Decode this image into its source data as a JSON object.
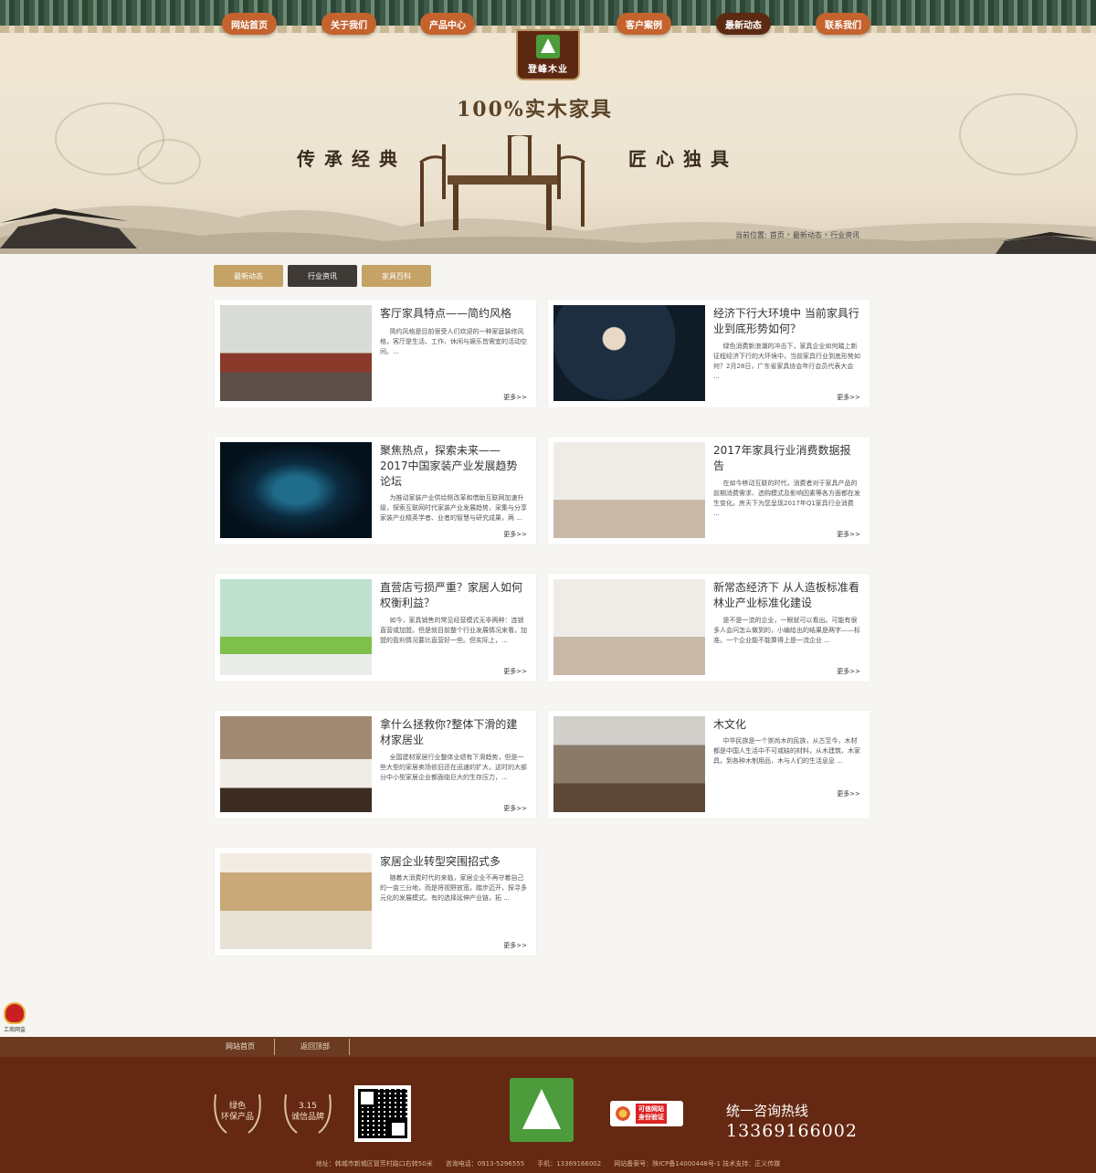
{
  "nav": {
    "items": [
      {
        "label": "网站首页",
        "active": false
      },
      {
        "label": "关于我们",
        "active": false
      },
      {
        "label": "产品中心",
        "active": false
      },
      {
        "label": "客户案例",
        "active": false
      },
      {
        "label": "最新动态",
        "active": true
      },
      {
        "label": "联系我们",
        "active": false
      }
    ],
    "logo_text": "登峰木业"
  },
  "banner": {
    "slogan": "100%实木家具",
    "left_text": "传承经典",
    "right_text": "匠心独具"
  },
  "breadcrumb": {
    "prefix": "当前位置:",
    "items": [
      "首页",
      "最新动态",
      "行业资讯"
    ],
    "separator": "›"
  },
  "tabs": [
    {
      "label": "最新动态",
      "active": false
    },
    {
      "label": "行业资讯",
      "active": true
    },
    {
      "label": "家具百科",
      "active": false
    }
  ],
  "articles": [
    {
      "title": "客厅家具特点——简约风格",
      "summary": "简约风格是目前很受人们欢迎的一种家庭装修风格，客厅是生活、工作、休闲与娱乐皆需宜的活动空间。...",
      "more": "更多>>"
    },
    {
      "title": "经济下行大环境中 当前家具行业到底形势如何？",
      "summary": "绿色消费新浪潮的冲击下，家具企业如何踏上新征程经济下行的大环境中，当前家具行业到底形势如何？2月28日，广东省家具协会年行会员代表大会 ...",
      "more": "更多>>"
    },
    {
      "title": "聚焦热点，探索未来——2017中国家装产业发展趋势论坛",
      "summary": "为推动家装产业供给侧改革和借助互联网加速升级，探索互联网时代家装产业发展趋势，采集与分享家装产业精英学者、业者的智慧与研究成果，两 ...",
      "more": "更多>>"
    },
    {
      "title": "2017年家具行业消费数据报告",
      "summary": "在如今移动互联的时代，消费者对于家具产品的前期消费需求、选购模式及影响因素等各方面都在发生变化。房天下为您呈现2017年Q1家具行业消费 ...",
      "more": "更多>>"
    },
    {
      "title": "直营店亏损严重？家居人如何权衡利益？",
      "summary": "如今，家具销售的常见经营模式无非两种：连锁直营或加盟。但是就目前整个行业发展情况来看，加盟的盈利情况要比直营好一些。但实际上，...",
      "more": "更多>>"
    },
    {
      "title": "新常态经济下 从人造板标准看林业产业标准化建设",
      "summary": "是不是一流的企业，一眼就可以看出。可能有很多人会问怎么做到的，小编给出的结果是两字——标准。一个企业能不能算得上是一流企业 ...",
      "more": "更多>>"
    },
    {
      "title": "拿什么拯救你?整体下滑的建材家居业",
      "summary": "全国建材家居行业整体业绩有下滑趋势，但是一些大型的家居卖场依旧还在迅速的扩大，这时的大部分中小型家居企业都面临巨大的生存压力，...",
      "more": "更多>>"
    },
    {
      "title": "木文化",
      "summary": "中华民族是一个崇尚木的民族，从古至今，木材都是中国人生活中不可或缺的材料，从木建筑、木家具，到各种木制用品，木与人们的生活息息 ...",
      "more": "更多>>"
    },
    {
      "title": "家居企业转型突围招式多",
      "summary": "随着大消费时代的来临，家居企业不再守着自己的一亩三分地，而是将视野放宽，踏步迈开，探寻多元化的发展模式。有的选择延伸产业链，拓 ...",
      "more": "更多>>"
    }
  ],
  "footer": {
    "links": [
      "网站首页",
      "返回顶部"
    ],
    "badge1": {
      "line1": "绿色",
      "line2": "环保产品"
    },
    "badge2": {
      "line1": "3.15",
      "line2": "诚信品牌"
    },
    "trust_text": {
      "line1": "可信网站",
      "line2": "身份验证"
    },
    "hotline_label": "统一咨询热线",
    "hotline_number": "13369166002",
    "address": "地址：韩城市新城区冒芳村路口右转50米　　咨询电话：0913-5296555　　手机：13369166002　　网站备案号：陕ICP备14000448号-1 技术支持：正义传媒",
    "gov_label": "工商网监"
  }
}
